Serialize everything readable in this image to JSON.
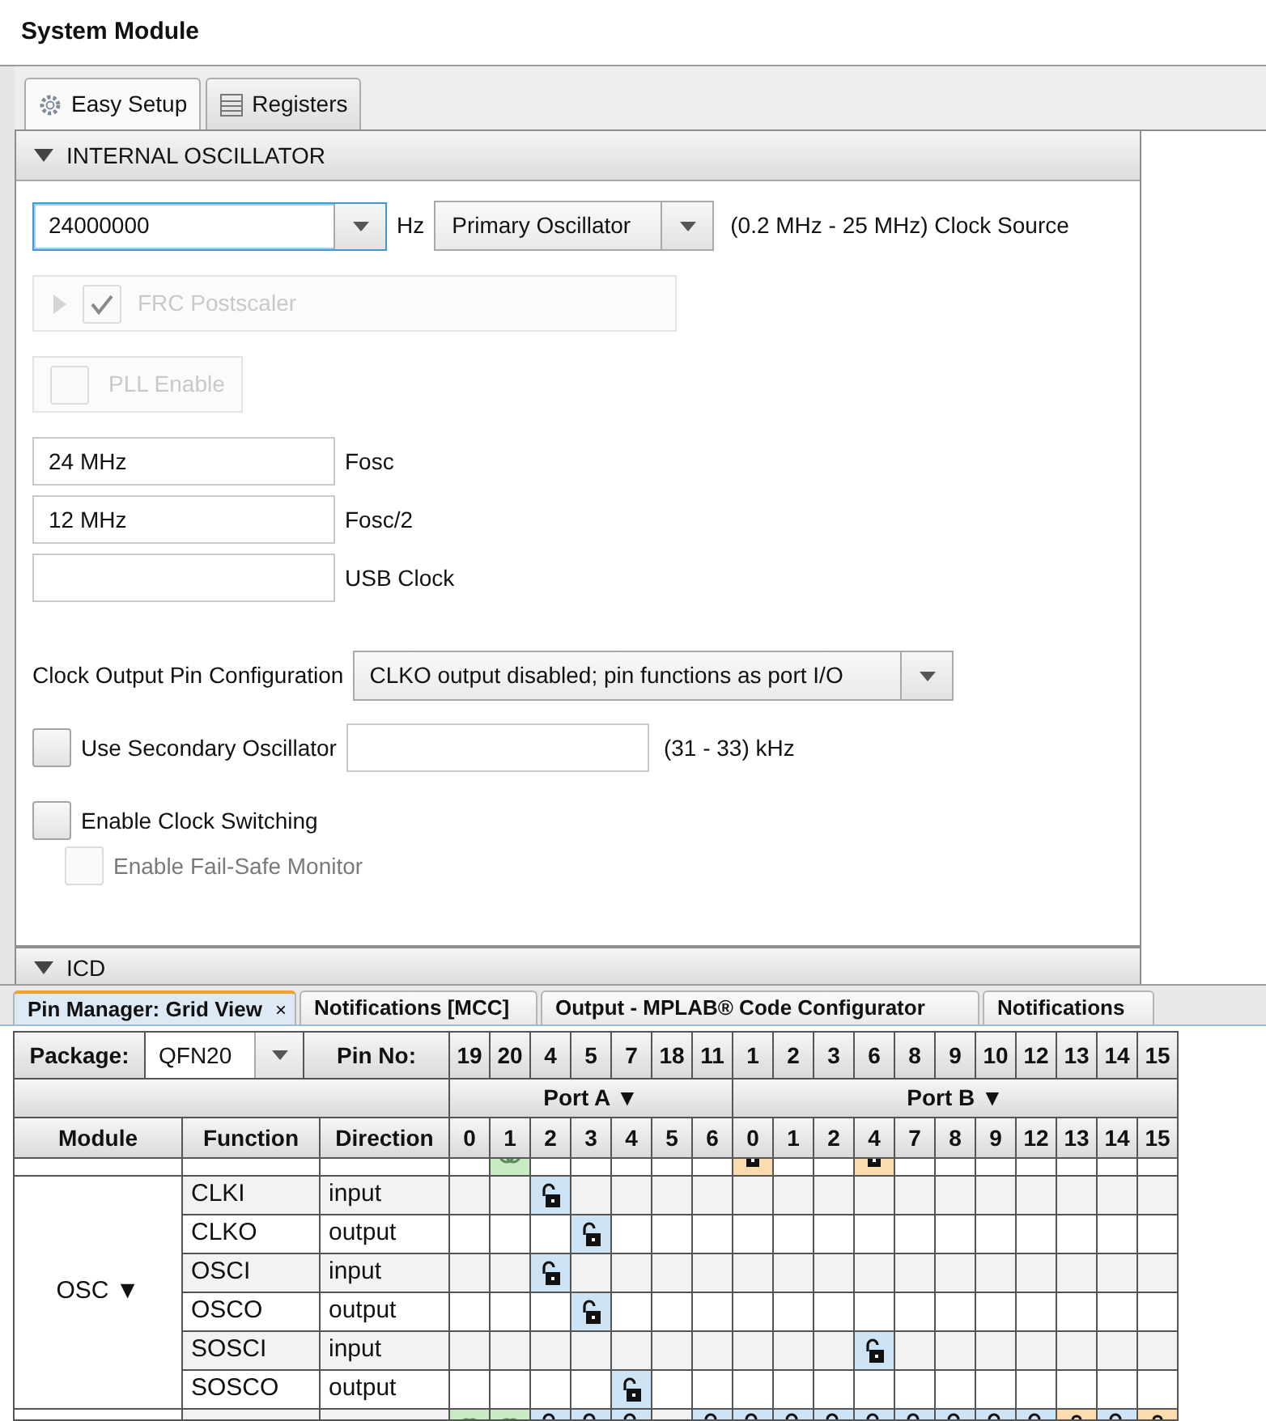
{
  "window": {
    "title": "System Module"
  },
  "tabs": [
    {
      "label": "Easy Setup",
      "selected": true
    },
    {
      "label": "Registers",
      "selected": false
    }
  ],
  "section": {
    "title": "INTERNAL OSCILLATOR",
    "expanded": true
  },
  "frequency": {
    "value": "24000000",
    "unit": "Hz",
    "focused": true
  },
  "clock_source": {
    "value": "Primary Oscillator",
    "note": "(0.2 MHz - 25 MHz) Clock Source"
  },
  "frc_postscaler": {
    "label": "FRC Postscaler",
    "checked": true,
    "disabled": true
  },
  "pll_enable": {
    "label": "PLL Enable",
    "checked": false,
    "disabled": true
  },
  "outputs": [
    {
      "value": "24 MHz",
      "label": "Fosc"
    },
    {
      "value": "12 MHz",
      "label": "Fosc/2"
    },
    {
      "label": "USB Clock"
    }
  ],
  "clock_output": {
    "label": "Clock Output Pin Configuration",
    "value": "CLKO output disabled; pin functions as port I/O"
  },
  "secondary_oscillator": {
    "label": "Use Secondary Oscillator",
    "checked": false,
    "note": "(31 - 33) kHz"
  },
  "clock_switching": {
    "label": "Enable Clock Switching",
    "checked": false,
    "disabled": false
  },
  "fail_safe": {
    "label": "Enable Fail-Safe Monitor",
    "checked": false,
    "disabled": true
  },
  "next_section": {
    "title": "ICD",
    "expanded": true
  },
  "bottom_tabs": [
    {
      "label": "Pin Manager: Grid View",
      "close": "×",
      "selected": true
    },
    {
      "label": "Notifications [MCC]",
      "selected": false
    },
    {
      "label": "Output - MPLAB® Code Configurator",
      "selected": false
    },
    {
      "label": "Notifications",
      "selected": false
    }
  ],
  "pin_grid": {
    "package_label": "Package:",
    "package": "QFN20",
    "pin_label": "Pin No:",
    "pins": [
      "19",
      "20",
      "4",
      "5",
      "7",
      "18",
      "11",
      "1",
      "2",
      "3",
      "6",
      "8",
      "9",
      "10",
      "12",
      "13",
      "14",
      "15"
    ],
    "ports": [
      {
        "label": "Port A ▼",
        "bits": [
          "0",
          "1",
          "2",
          "3",
          "4",
          "5",
          "6"
        ]
      },
      {
        "label": "Port B ▼",
        "bits": [
          "0",
          "1",
          "2",
          "4",
          "7",
          "8",
          "9",
          "12",
          "13",
          "14",
          "15"
        ]
      }
    ],
    "columns": [
      "Module",
      "Function",
      "Direction"
    ],
    "groups": [
      {
        "rows": [
          {
            "cells": [
              {
                "kind": "empty"
              },
              {
                "kind": "linked",
                "color": "#c9ebc3"
              },
              {
                "kind": "empty"
              },
              {
                "kind": "empty"
              },
              {
                "kind": "empty"
              },
              {
                "kind": "empty"
              },
              {
                "kind": "empty"
              },
              {
                "kind": "locked",
                "color": "#fcdcae"
              },
              {
                "kind": "empty"
              },
              {
                "kind": "empty"
              },
              {
                "kind": "locked",
                "color": "#fcdcae"
              },
              {
                "kind": "empty"
              },
              {
                "kind": "empty"
              },
              {
                "kind": "empty"
              },
              {
                "kind": "empty"
              },
              {
                "kind": "empty"
              },
              {
                "kind": "empty"
              },
              {
                "kind": "empty"
              }
            ]
          }
        ]
      },
      {
        "module": "OSC ▼",
        "rows": [
          {
            "function": "CLKI",
            "direction": "input",
            "cells": [
              {
                "kind": "empty"
              },
              {
                "kind": "empty"
              },
              {
                "kind": "unlocked",
                "color": "#cde4f7"
              },
              {
                "kind": "empty"
              },
              {
                "kind": "empty"
              },
              {
                "kind": "empty"
              },
              {
                "kind": "empty"
              },
              {
                "kind": "empty"
              },
              {
                "kind": "empty"
              },
              {
                "kind": "empty"
              },
              {
                "kind": "empty"
              },
              {
                "kind": "empty"
              },
              {
                "kind": "empty"
              },
              {
                "kind": "empty"
              },
              {
                "kind": "empty"
              },
              {
                "kind": "empty"
              },
              {
                "kind": "empty"
              },
              {
                "kind": "empty"
              }
            ]
          },
          {
            "function": "CLKO",
            "direction": "output",
            "cells": [
              {
                "kind": "empty"
              },
              {
                "kind": "empty"
              },
              {
                "kind": "empty"
              },
              {
                "kind": "unlocked",
                "color": "#cde4f7"
              },
              {
                "kind": "empty"
              },
              {
                "kind": "empty"
              },
              {
                "kind": "empty"
              },
              {
                "kind": "empty"
              },
              {
                "kind": "empty"
              },
              {
                "kind": "empty"
              },
              {
                "kind": "empty"
              },
              {
                "kind": "empty"
              },
              {
                "kind": "empty"
              },
              {
                "kind": "empty"
              },
              {
                "kind": "empty"
              },
              {
                "kind": "empty"
              },
              {
                "kind": "empty"
              },
              {
                "kind": "empty"
              }
            ]
          },
          {
            "function": "OSCI",
            "direction": "input",
            "cells": [
              {
                "kind": "empty"
              },
              {
                "kind": "empty"
              },
              {
                "kind": "unlocked",
                "color": "#cde4f7"
              },
              {
                "kind": "empty"
              },
              {
                "kind": "empty"
              },
              {
                "kind": "empty"
              },
              {
                "kind": "empty"
              },
              {
                "kind": "empty"
              },
              {
                "kind": "empty"
              },
              {
                "kind": "empty"
              },
              {
                "kind": "empty"
              },
              {
                "kind": "empty"
              },
              {
                "kind": "empty"
              },
              {
                "kind": "empty"
              },
              {
                "kind": "empty"
              },
              {
                "kind": "empty"
              },
              {
                "kind": "empty"
              },
              {
                "kind": "empty"
              }
            ]
          },
          {
            "function": "OSCO",
            "direction": "output",
            "cells": [
              {
                "kind": "empty"
              },
              {
                "kind": "empty"
              },
              {
                "kind": "empty"
              },
              {
                "kind": "unlocked",
                "color": "#cde4f7"
              },
              {
                "kind": "empty"
              },
              {
                "kind": "empty"
              },
              {
                "kind": "empty"
              },
              {
                "kind": "empty"
              },
              {
                "kind": "empty"
              },
              {
                "kind": "empty"
              },
              {
                "kind": "empty"
              },
              {
                "kind": "empty"
              },
              {
                "kind": "empty"
              },
              {
                "kind": "empty"
              },
              {
                "kind": "empty"
              },
              {
                "kind": "empty"
              },
              {
                "kind": "empty"
              },
              {
                "kind": "empty"
              }
            ]
          },
          {
            "function": "SOSCI",
            "direction": "input",
            "cells": [
              {
                "kind": "empty"
              },
              {
                "kind": "empty"
              },
              {
                "kind": "empty"
              },
              {
                "kind": "empty"
              },
              {
                "kind": "empty"
              },
              {
                "kind": "empty"
              },
              {
                "kind": "empty"
              },
              {
                "kind": "empty"
              },
              {
                "kind": "empty"
              },
              {
                "kind": "empty"
              },
              {
                "kind": "unlocked",
                "color": "#cde4f7"
              },
              {
                "kind": "empty"
              },
              {
                "kind": "empty"
              },
              {
                "kind": "empty"
              },
              {
                "kind": "empty"
              },
              {
                "kind": "empty"
              },
              {
                "kind": "empty"
              },
              {
                "kind": "empty"
              }
            ]
          },
          {
            "function": "SOSCO",
            "direction": "output",
            "cells": [
              {
                "kind": "empty"
              },
              {
                "kind": "empty"
              },
              {
                "kind": "empty"
              },
              {
                "kind": "empty"
              },
              {
                "kind": "unlocked",
                "color": "#cde4f7"
              },
              {
                "kind": "empty"
              },
              {
                "kind": "empty"
              },
              {
                "kind": "empty"
              },
              {
                "kind": "empty"
              },
              {
                "kind": "empty"
              },
              {
                "kind": "empty"
              },
              {
                "kind": "empty"
              },
              {
                "kind": "empty"
              },
              {
                "kind": "empty"
              },
              {
                "kind": "empty"
              },
              {
                "kind": "empty"
              },
              {
                "kind": "empty"
              },
              {
                "kind": "empty"
              }
            ]
          }
        ]
      },
      {
        "rows": [
          {
            "cells": [
              {
                "kind": "linked",
                "color": "#c9ebc3"
              },
              {
                "kind": "linked",
                "color": "#c9ebc3"
              },
              {
                "kind": "unlocked",
                "color": "#cde4f7"
              },
              {
                "kind": "unlocked",
                "color": "#cde4f7"
              },
              {
                "kind": "unlocked",
                "color": "#cde4f7"
              },
              {
                "kind": "empty"
              },
              {
                "kind": "unlocked",
                "color": "#cde4f7"
              },
              {
                "kind": "unlocked",
                "color": "#cde4f7"
              },
              {
                "kind": "unlocked",
                "color": "#cde4f7"
              },
              {
                "kind": "unlocked",
                "color": "#cde4f7"
              },
              {
                "kind": "unlocked",
                "color": "#cde4f7"
              },
              {
                "kind": "unlocked",
                "color": "#cde4f7"
              },
              {
                "kind": "unlocked",
                "color": "#cde4f7"
              },
              {
                "kind": "unlocked",
                "color": "#cde4f7"
              },
              {
                "kind": "unlocked",
                "color": "#cde4f7"
              },
              {
                "kind": "locked",
                "color": "#fcdcae"
              },
              {
                "kind": "unlocked",
                "color": "#cde4f7"
              },
              {
                "kind": "locked",
                "color": "#fcdcae"
              }
            ]
          }
        ]
      }
    ]
  }
}
